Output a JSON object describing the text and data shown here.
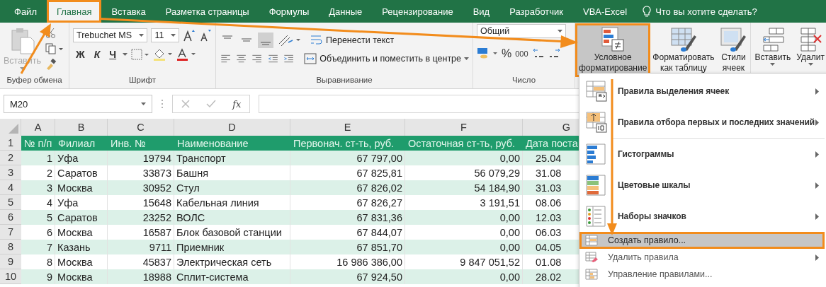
{
  "tabs": [
    {
      "label": "Файл",
      "selected": false,
      "highlighted": false
    },
    {
      "label": "Главная",
      "selected": true,
      "highlighted": true
    },
    {
      "label": "Вставка",
      "selected": false,
      "highlighted": false
    },
    {
      "label": "Разметка страницы",
      "selected": false,
      "highlighted": false
    },
    {
      "label": "Формулы",
      "selected": false,
      "highlighted": false
    },
    {
      "label": "Данные",
      "selected": false,
      "highlighted": false
    },
    {
      "label": "Рецензирование",
      "selected": false,
      "highlighted": false
    },
    {
      "label": "Вид",
      "selected": false,
      "highlighted": false
    },
    {
      "label": "Разработчик",
      "selected": false,
      "highlighted": false
    },
    {
      "label": "VBA-Excel",
      "selected": false,
      "highlighted": false
    }
  ],
  "search": {
    "placeholder": "Что вы хотите сделать?"
  },
  "ribbon": {
    "clipboard": {
      "group": "Буфер обмена",
      "paste_label": "Вставить",
      "paste_disabled": true
    },
    "font": {
      "group": "Шрифт",
      "family": "Trebuchet MS",
      "size": "11",
      "styles": [
        {
          "label": "Ж",
          "kind": "bold"
        },
        {
          "label": "К",
          "kind": "italic"
        },
        {
          "label": "Ч",
          "kind": "underline"
        }
      ]
    },
    "alignment": {
      "group": "Выравнивание",
      "wrap": "Перенести текст",
      "merge": "Объединить и поместить в центре"
    },
    "number": {
      "group": "Число",
      "format": "Общий",
      "percent": "%",
      "thousands": "000"
    },
    "styles": {
      "buttons": [
        {
          "lines": [
            "Условное",
            "форматирование"
          ],
          "selected": true,
          "highlighted": true
        },
        {
          "lines": [
            "Форматировать",
            "как таблицу"
          ],
          "selected": false,
          "highlighted": false
        },
        {
          "lines": [
            "Стили",
            "ячеек"
          ],
          "selected": false,
          "highlighted": false
        }
      ]
    },
    "cells": {
      "buttons": [
        {
          "label": "Вставить"
        },
        {
          "label": "Удалит"
        }
      ]
    }
  },
  "formula_bar": {
    "name_box": "M20",
    "function_label": "fx"
  },
  "sheet": {
    "column_letters": [
      "A",
      "B",
      "C",
      "D",
      "E",
      "F",
      "G"
    ],
    "header": {
      "number": "1",
      "cells": [
        "№ п/п",
        "Филиал",
        "Инв. №",
        "Наименование",
        "Первонач. ст-ть, руб.",
        "Остаточная ст-ть, руб.",
        "Дата поста"
      ]
    },
    "rows": [
      {
        "number": "2",
        "cells": [
          "1",
          "Уфа",
          "19794",
          "Транспорт",
          "67 797,00",
          "0,00",
          "25.04"
        ]
      },
      {
        "number": "3",
        "cells": [
          "2",
          "Саратов",
          "33873",
          "Башня",
          "67 825,81",
          "56 079,29",
          "31.08"
        ]
      },
      {
        "number": "4",
        "cells": [
          "3",
          "Москва",
          "30952",
          "Стул",
          "67 826,02",
          "54 184,90",
          "31.03"
        ]
      },
      {
        "number": "5",
        "cells": [
          "4",
          "Уфа",
          "15648",
          "Кабельная линия",
          "67 826,27",
          "3 191,51",
          "08.06"
        ]
      },
      {
        "number": "6",
        "cells": [
          "5",
          "Саратов",
          "23252",
          "ВОЛС",
          "67 831,36",
          "0,00",
          "12.03"
        ]
      },
      {
        "number": "7",
        "cells": [
          "6",
          "Москва",
          "16587",
          "Блок базовой станции",
          "67 844,07",
          "0,00",
          "06.03"
        ]
      },
      {
        "number": "8",
        "cells": [
          "7",
          "Казань",
          "9711",
          "Приемник",
          "67 851,70",
          "0,00",
          "04.05"
        ]
      },
      {
        "number": "9",
        "cells": [
          "8",
          "Москва",
          "45837",
          "Электрическая сеть",
          "16 986 386,00",
          "9 847 051,52",
          "01.08"
        ]
      },
      {
        "number": "10",
        "cells": [
          "9",
          "Москва",
          "18988",
          "Сплит-система",
          "67 924,50",
          "0,00",
          "28.02"
        ]
      }
    ]
  },
  "menu": {
    "items": [
      {
        "kind": "large",
        "label": "Правила выделения ячеек",
        "submenu": true,
        "selected": false,
        "highlighted": false
      },
      {
        "kind": "large",
        "label": "Правила отбора первых и последних значений",
        "submenu": true,
        "selected": false,
        "highlighted": false
      },
      {
        "kind": "separator"
      },
      {
        "kind": "large",
        "label": "Гистограммы",
        "submenu": true,
        "selected": false,
        "highlighted": false
      },
      {
        "kind": "large",
        "label": "Цветовые шкалы",
        "submenu": true,
        "selected": false,
        "highlighted": false
      },
      {
        "kind": "large",
        "label": "Наборы значков",
        "submenu": true,
        "selected": false,
        "highlighted": false
      },
      {
        "kind": "small",
        "label": "Создать правило...",
        "submenu": false,
        "selected": true,
        "highlighted": true
      },
      {
        "kind": "small",
        "label": "Удалить правила",
        "submenu": true,
        "selected": false,
        "highlighted": false
      },
      {
        "kind": "small",
        "label": "Управление правилами...",
        "submenu": false,
        "selected": false,
        "highlighted": false
      }
    ]
  }
}
